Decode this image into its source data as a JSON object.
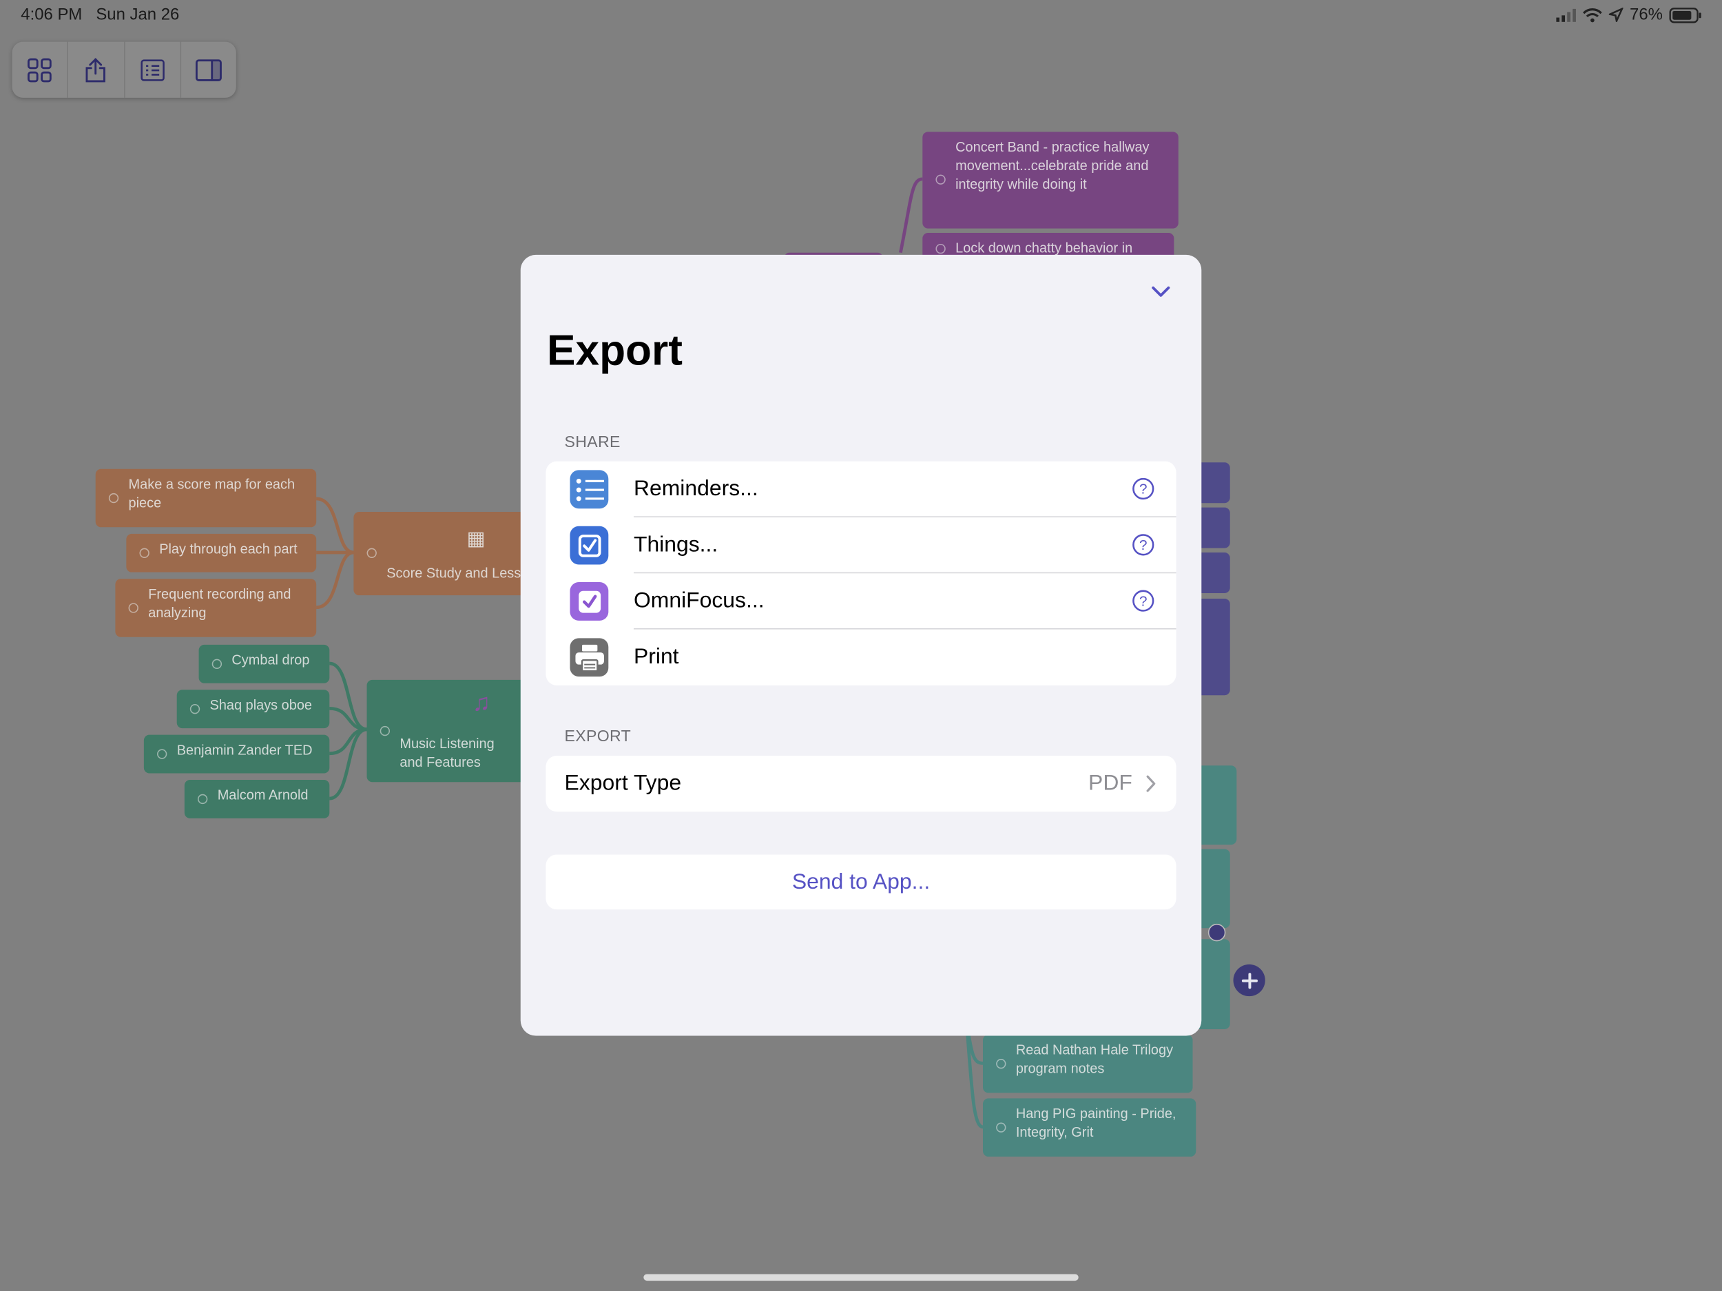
{
  "status": {
    "time": "4:06 PM",
    "date": "Sun Jan 26",
    "battery": "76%"
  },
  "toolbar": {
    "items": [
      "grid-icon",
      "share-icon",
      "outline-icon",
      "sidebar-icon"
    ]
  },
  "background_nodes": {
    "orange": {
      "center": "Score Study and Less",
      "items": [
        "Make a score map for each piece",
        "Play through each part",
        "Frequent recording and analyzing"
      ]
    },
    "green": {
      "center": "Music Listening and Features",
      "items": [
        "Cymbal drop",
        "Shaq plays oboe",
        "Benjamin Zander TED",
        "Malcom Arnold"
      ]
    },
    "purple": {
      "items": [
        "Concert Band - practice hallway movement...celebrate pride and integrity while doing it",
        "Lock down chatty behavior in"
      ]
    },
    "teal": {
      "items": [
        "Read Nathan Hale Trilogy program notes",
        "Hang PIG painting - Pride, Integrity, Grit"
      ]
    }
  },
  "modal": {
    "title": "Export",
    "share_header": "SHARE",
    "share_items": [
      {
        "label": "Reminders...",
        "icon": "reminders-icon",
        "help": true
      },
      {
        "label": "Things...",
        "icon": "things-icon",
        "help": true
      },
      {
        "label": "OmniFocus...",
        "icon": "omnifocus-icon",
        "help": true
      },
      {
        "label": "Print",
        "icon": "printer-icon",
        "help": false
      }
    ],
    "export_header": "EXPORT",
    "export_type_label": "Export Type",
    "export_type_value": "PDF",
    "send_label": "Send to App..."
  },
  "colors": {
    "accent": "#5652c4",
    "reminders": "#3a7bd5",
    "things": "#3b6fd6",
    "omnifocus": "#8e5fd8",
    "print": "#6f6f6f"
  }
}
